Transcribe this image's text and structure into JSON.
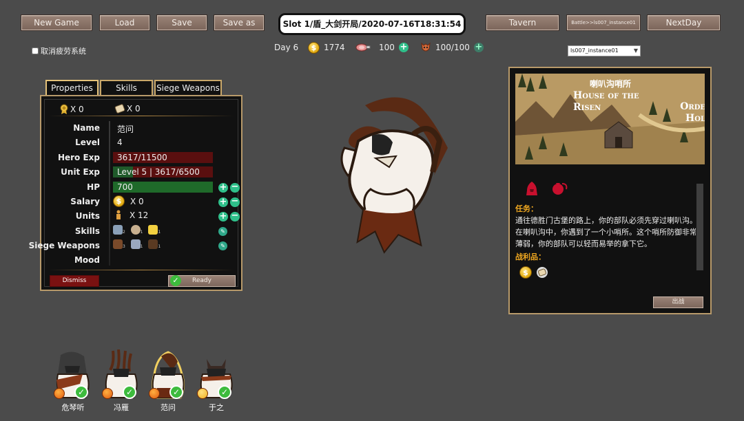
{
  "toolbar": {
    "new_game": "New Game",
    "load": "Load",
    "save": "Save",
    "save_as": "Save as",
    "tavern": "Tavern",
    "battle": "Battle>>ls007_instance01",
    "next_day": "NextDay"
  },
  "slot_title": "Slot 1/盾_大剑开局/2020-07-16T18:31:54",
  "fatigue_toggle": {
    "label": "取消疲劳系统",
    "checked": false
  },
  "resources": {
    "day": "Day 6",
    "gold": "1774",
    "food": "100",
    "morale": "100/100"
  },
  "instance_select": {
    "value": "ls007_instance01"
  },
  "tabs": [
    "Properties",
    "Skills",
    "Siege Weapons"
  ],
  "hero": {
    "medals": "X 0",
    "scrolls": "X 0",
    "labels": {
      "name": "Name",
      "level": "Level",
      "hero_exp": "Hero Exp",
      "unit_exp": "Unit Exp",
      "hp": "HP",
      "salary": "Salary",
      "units": "Units",
      "skills": "Skills",
      "siege_weapons": "Siege Weapons",
      "mood": "Mood"
    },
    "name": "范问",
    "level": "4",
    "hero_exp": "3617/11500",
    "unit_exp": "Level 5 | 3617/6500",
    "hp": "700",
    "salary": "X 0",
    "units": "X 12",
    "skill_counts": [
      "2",
      "1",
      "1"
    ],
    "siege_counts": [
      "3",
      "1",
      "1"
    ],
    "mood": ""
  },
  "buttons": {
    "dismiss": "Dismiss",
    "ready": "Ready"
  },
  "mission": {
    "location": "喇叭沟哨所",
    "image_caption": "House of the Risen",
    "image_caption_right": "Orde Hol",
    "task_heading": "任务：",
    "task_lines": [
      "通往德胜门古堡的路上，你的部队必须先穿过喇叭沟。",
      "在喇叭沟中，你遇到了一个小哨所。这个哨所防御非常",
      "薄弱，你的部队可以轻而易举的拿下它。"
    ],
    "loot_heading": "战利品：",
    "go_button": "出战"
  },
  "party": [
    {
      "name": "危琴听",
      "mood": "angry",
      "ready": true,
      "selected": false
    },
    {
      "name": "冯雁",
      "mood": "angry",
      "ready": true,
      "selected": false
    },
    {
      "name": "范问",
      "mood": "angry",
      "ready": true,
      "selected": true
    },
    {
      "name": "于之",
      "mood": "happy",
      "ready": true,
      "selected": false
    }
  ],
  "colors": {
    "background": "#4b4b4b",
    "button": "#8b7367",
    "hero_exp_bar": "#5a0f0f",
    "unit_exp_bar": "#1f5a2a",
    "hp_bar": "#1f6a2a",
    "dismiss": "#7a1111",
    "accent_plus": "#2fbf8a",
    "heading_orange": "#f0a820"
  }
}
